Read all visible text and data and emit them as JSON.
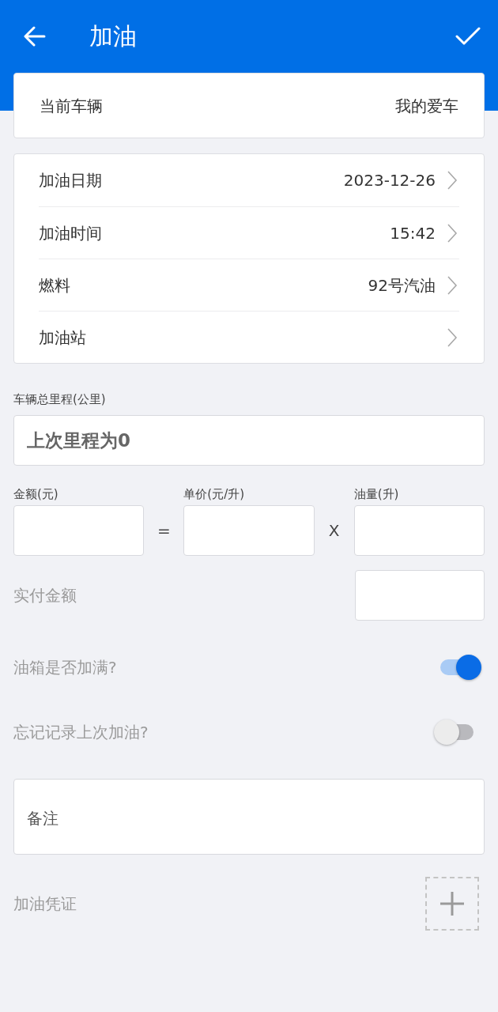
{
  "app_bar": {
    "title": "加油"
  },
  "vehicle": {
    "label": "当前车辆",
    "value": "我的爱车"
  },
  "details": [
    {
      "label": "加油日期",
      "value": "2023-12-26"
    },
    {
      "label": "加油时间",
      "value": "15:42"
    },
    {
      "label": "燃料",
      "value": "92号汽油"
    },
    {
      "label": "加油站"
    }
  ],
  "odometer": {
    "label": "车辆总里程(公里)",
    "placeholder": "上次里程为0"
  },
  "calculation": [
    {
      "label": "金额(元)"
    },
    {
      "label": "单价(元/升)",
      "operator": "="
    },
    {
      "label": "油量(升)",
      "operator": "X"
    }
  ],
  "actual_payment": {
    "label": "实付金额"
  },
  "toggles": [
    {
      "label": "油箱是否加满?",
      "on": true
    },
    {
      "label": "忘记记录上次加油?",
      "on": false
    }
  ],
  "note": {
    "placeholder": "备注"
  },
  "receipt": {
    "label": "加油凭证"
  }
}
